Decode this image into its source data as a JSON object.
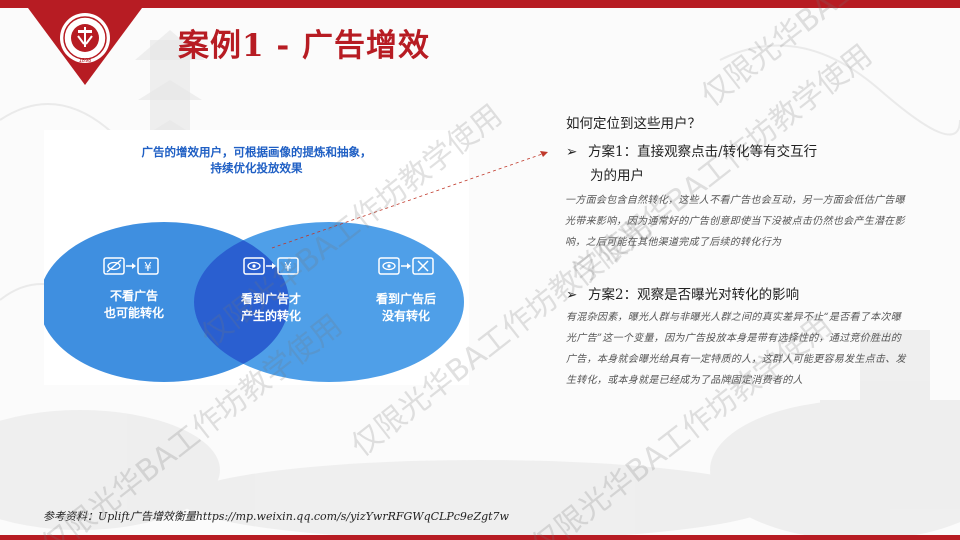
{
  "title": "案例1 - 广告增效",
  "diagram": {
    "caption_line1": "广告的增效用户，可根据画像的提炼和抽象，",
    "caption_line2": "持续优化投放效果",
    "left_label_line1": "不看广告",
    "left_label_line2": "也可能转化",
    "center_label_line1": "看到广告才",
    "center_label_line2": "产生的转化",
    "right_label_line1": "看到广告后",
    "right_label_line2": "没有转化",
    "icon_yen": "¥",
    "icon_cross": "✕",
    "colors": {
      "left": "#3f8fe0",
      "right": "#4f9fe8",
      "overlap": "#2a5fd0",
      "caption": "#1f5fc4"
    }
  },
  "right": {
    "question": "如何定位到这些用户？",
    "scheme1_line1": "方案1：直接观察点击/转化等有交互行",
    "scheme1_line2": "为的用户",
    "scheme1_note": "一方面会包含自然转化，这些人不看广告也会互动，另一方面会低估广告曝光带来影响，因为通常好的广告创意即使当下没被点击仍然也会产生潜在影响，之后可能在其他渠道完成了后续的转化行为",
    "scheme2_line1": "方案2：观察是否曝光对转化的影响",
    "scheme2_note": "有混杂因素，曝光人群与非曝光人群之间的真实差异不止“是否看了本次曝光广告”这一个变量，因为广告投放本身是带有选择性的，通过竞价胜出的广告，本身就会曝光给具有一定特质的人，这群人可能更容易发生点击、发生转化，或本身就是已经成为了品牌固定消费者的人",
    "bullet": "➢"
  },
  "reference": "参考资料：Uplift广告增效衡量https://mp.weixin.qq.com/s/yizYwrRFGWqCLPc9eZgt7w",
  "logo": {
    "year": "1898",
    "arc_text": "PEKING UNIVERSITY"
  },
  "watermarks": [
    "仅限光华BA工作坊教学使用",
    "仅限光华BA工作坊教学使用",
    "仅限光华BA工作坊教学使用",
    "仅限光华BA工作坊教学使用",
    "仅限光华BA工作坊教学使用",
    "仅限光华BA工作坊教学使用"
  ],
  "colors": {
    "brand": "#b71c23"
  }
}
